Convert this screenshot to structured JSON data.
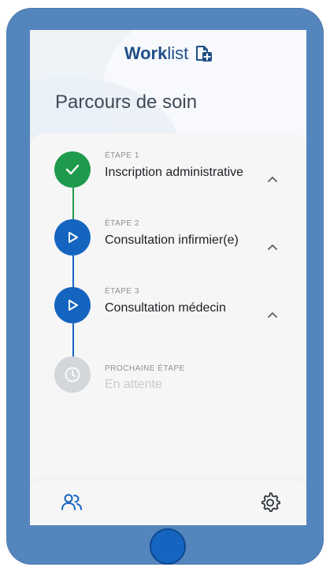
{
  "app": {
    "brand_part1": "Work",
    "brand_part2": "list",
    "brand_icon": "add-document-icon"
  },
  "page": {
    "title": "Parcours de soin"
  },
  "steps": [
    {
      "kicker": "ÉTAPE 1",
      "name": "Inscription administrative",
      "status": "done",
      "icon": "check-icon",
      "color": "#1e9a4c",
      "expand_icon": "chevron-up-icon"
    },
    {
      "kicker": "ÉTAPE 2",
      "name": "Consultation infirmier(e)",
      "status": "in-progress",
      "icon": "play-icon",
      "color": "#1565c0",
      "expand_icon": "chevron-up-icon"
    },
    {
      "kicker": "ÉTAPE 3",
      "name": "Consultation médecin",
      "status": "in-progress",
      "icon": "play-icon",
      "color": "#1565c0",
      "expand_icon": "chevron-up-icon"
    },
    {
      "kicker": "PROCHAINE ÉTAPE",
      "name": "En attente",
      "status": "pending",
      "icon": "clock-icon",
      "color": "#d3d6da"
    }
  ],
  "bottom_nav": [
    {
      "name": "patients",
      "icon": "users-icon",
      "active": true
    },
    {
      "name": "settings",
      "icon": "gear-icon",
      "active": false
    }
  ],
  "colors": {
    "device": "#5585bd",
    "brand": "#1f4f86",
    "done": "#1e9a4c",
    "active": "#1565c0",
    "pending": "#d3d6da"
  }
}
